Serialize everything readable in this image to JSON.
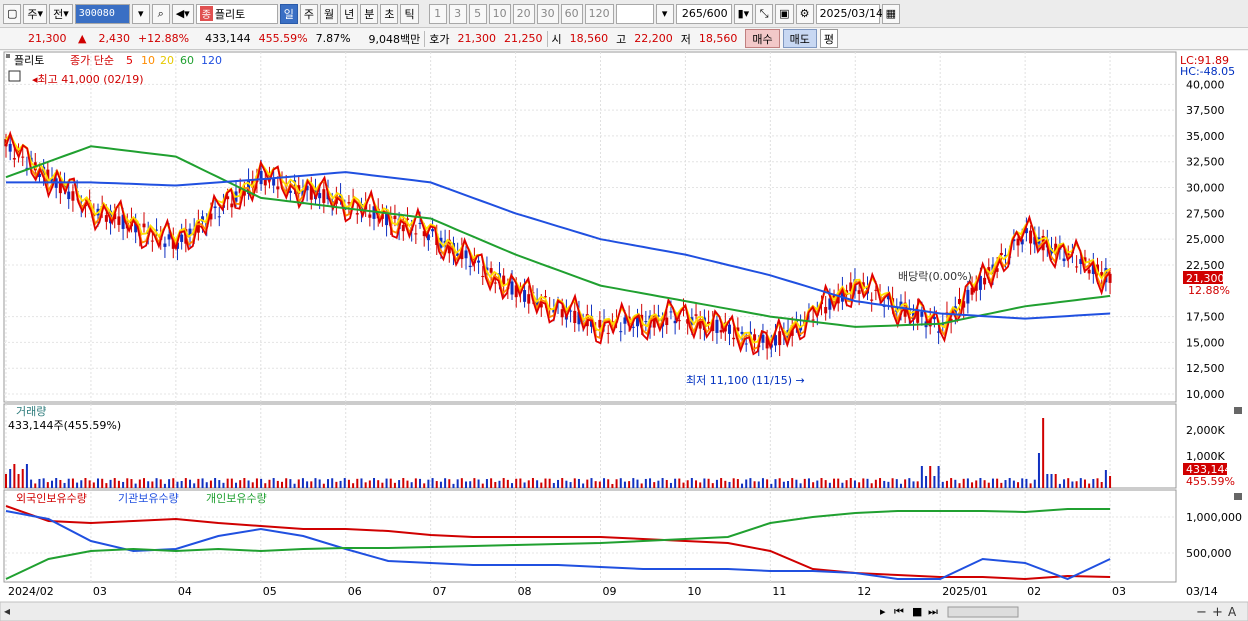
{
  "toolbar": {
    "market_label": "주",
    "prev_label": "전",
    "stock_code": "300080",
    "name_tag": "종",
    "stock_name": "플리토",
    "periods": [
      "일",
      "주",
      "월",
      "년",
      "분",
      "초",
      "틱"
    ],
    "active_period": "일",
    "intervals": [
      "1",
      "3",
      "5",
      "10",
      "20",
      "30",
      "60",
      "120"
    ],
    "count": "265",
    "count_total": "/600",
    "date": "2025/03/14"
  },
  "info": {
    "price": "21,300",
    "change_arrow": "▲",
    "change": "2,430",
    "change_pct": "+12.88%",
    "volume": "433,144",
    "volume_ratio": "455.59%",
    "turnover": "7.87%",
    "amount": "9,048백만",
    "hoga_label": "호가",
    "ask": "21,300",
    "bid": "21,250",
    "open_label": "시",
    "open": "18,560",
    "high_label": "고",
    "high": "22,200",
    "low_label": "저",
    "low": "18,560",
    "buy_label": "매수",
    "sell_label": "매도",
    "avg_label": "평"
  },
  "price_panel": {
    "stock_name": "플리토",
    "ma_label": "종가 단순",
    "ma_periods": [
      "5",
      "10",
      "20",
      "60",
      "120"
    ],
    "ma_colors": [
      "#e00000",
      "#ff8c00",
      "#ffe000",
      "#20a030",
      "#2050e0"
    ],
    "lc_label": "LC:91.89",
    "hc_label": "HC:-48.05",
    "high_annotation": "최고 41,000 (02/19)",
    "low_annotation": "최저 11,100 (11/15)",
    "dividend_annotation": "배당락(0.00%)",
    "current_price_tag": "21,300",
    "current_pct_tag": "12.88%",
    "y_ticks": [
      "40,000",
      "37,500",
      "35,000",
      "32,500",
      "30,000",
      "27,500",
      "25,000",
      "22,500",
      "17,500",
      "15,000",
      "12,500",
      "10,000"
    ]
  },
  "volume_panel": {
    "title": "거래량",
    "value_label": "433,144주(455.59%)",
    "y_ticks": [
      "2,000K",
      "1,000K"
    ],
    "current_tag": "433,144",
    "current_pct_tag": "455.59%"
  },
  "holding_panel": {
    "series": [
      "외국인보유수량",
      "기관보유수량",
      "개인보유수량"
    ],
    "colors": [
      "#d00000",
      "#2050e0",
      "#20a030"
    ],
    "y_ticks": [
      "1,000,000",
      "500,000"
    ]
  },
  "x_axis": {
    "labels": [
      "2024/02",
      "03",
      "04",
      "05",
      "06",
      "07",
      "08",
      "09",
      "10",
      "11",
      "12",
      "2025/01",
      "02",
      "03"
    ],
    "last_label": "03/14"
  },
  "chart_data": {
    "type": "line",
    "title": "플리토",
    "x": [
      "2024/02",
      "2024/03",
      "2024/04",
      "2024/05",
      "2024/06",
      "2024/07",
      "2024/08",
      "2024/09",
      "2024/10",
      "2024/11",
      "2024/12",
      "2025/01",
      "2025/02",
      "2025/03"
    ],
    "series": [
      {
        "name": "종가",
        "values": [
          34000,
          28000,
          24500,
          31000,
          28500,
          25500,
          20000,
          16500,
          17500,
          14800,
          20500,
          16500,
          25500,
          21300
        ]
      },
      {
        "name": "120",
        "values": [
          30500,
          30500,
          30200,
          30800,
          31500,
          30500,
          27500,
          25000,
          23500,
          21500,
          19000,
          17800,
          17300,
          17800
        ]
      }
    ],
    "ylim": [
      10000,
      41000
    ]
  }
}
